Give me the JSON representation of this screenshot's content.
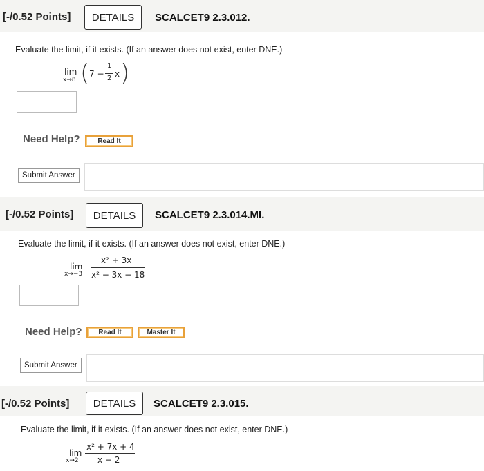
{
  "questions": [
    {
      "points": "[-/0.52 Points]",
      "details": "DETAILS",
      "code": "SCALCET9 2.3.012.",
      "prompt": "Evaluate the limit, if it exists. (If an answer does not exist, enter DNE.)",
      "math": {
        "lim": "lim",
        "sub": "x→8",
        "pre": "7 −",
        "num": "1",
        "den": "2",
        "post": "x"
      },
      "need_help": "Need Help?",
      "help_buttons": [
        "Read It"
      ],
      "submit": "Submit Answer"
    },
    {
      "points": "[-/0.52 Points]",
      "details": "DETAILS",
      "code": "SCALCET9 2.3.014.MI.",
      "prompt": "Evaluate the limit, if it exists. (If an answer does not exist, enter DNE.)",
      "math": {
        "lim": "lim",
        "sub": "x→−3",
        "num": "x² + 3x",
        "den": "x² − 3x − 18"
      },
      "need_help": "Need Help?",
      "help_buttons": [
        "Read It",
        "Master It"
      ],
      "submit": "Submit Answer"
    },
    {
      "points": "[-/0.52 Points]",
      "details": "DETAILS",
      "code": "SCALCET9 2.3.015.",
      "prompt": "Evaluate the limit, if it exists. (If an answer does not exist, enter DNE.)",
      "math": {
        "lim": "lim",
        "sub": "x→2",
        "num": "x² + 7x + 4",
        "den": "x − 2"
      }
    }
  ]
}
